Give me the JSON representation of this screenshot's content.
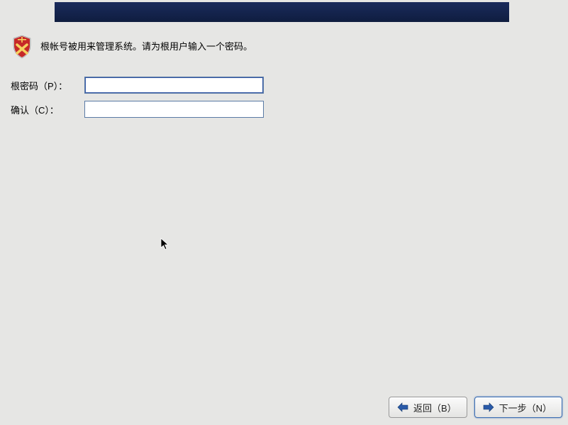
{
  "intro_text": "根帐号被用来管理系统。请为根用户输入一个密码。",
  "form": {
    "password_label": "根密码（P）：",
    "confirm_label": "确认（C）：",
    "password_value": "",
    "confirm_value": ""
  },
  "buttons": {
    "back_label": "返回（B）",
    "next_label": "下一步（N）"
  }
}
